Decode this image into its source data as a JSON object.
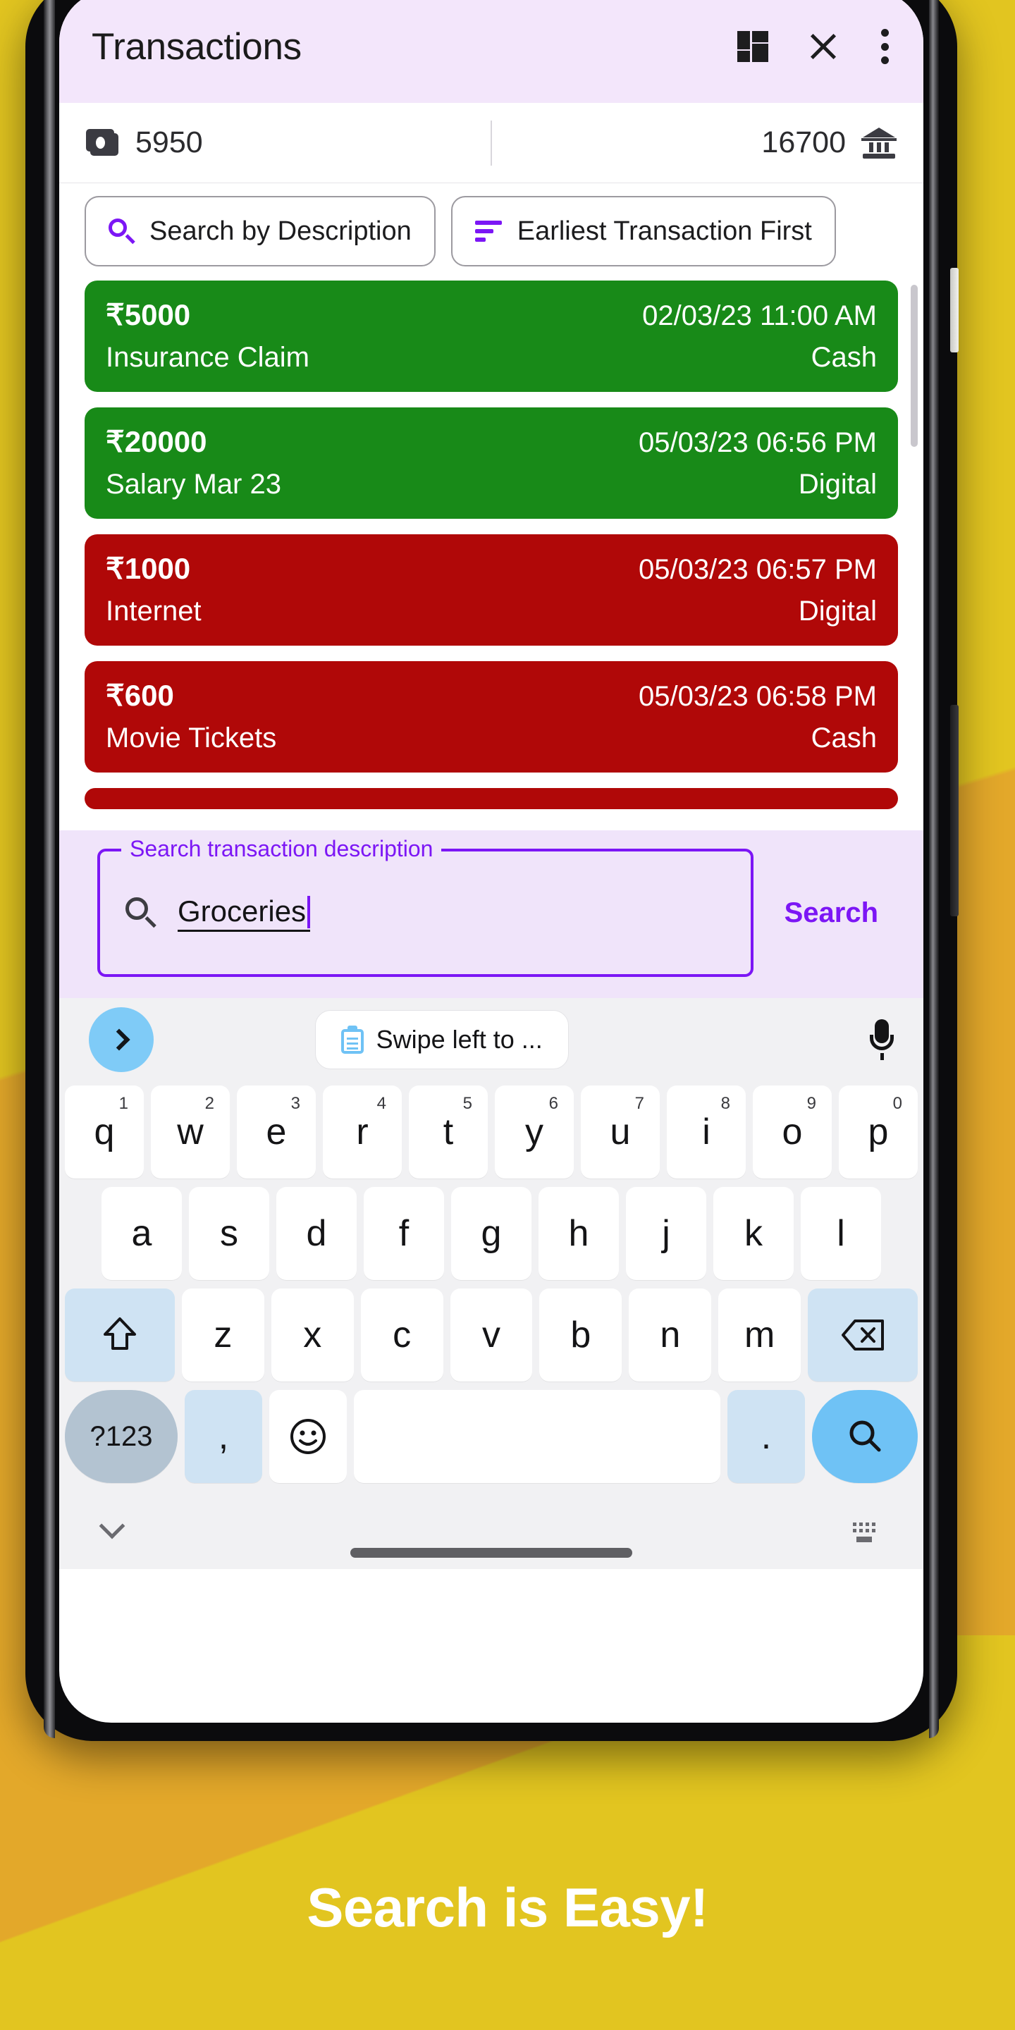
{
  "appbar": {
    "title": "Transactions",
    "icons": {
      "dashboard": "dashboard-icon",
      "close": "close-icon",
      "overflow": "more-vert-icon"
    }
  },
  "balances": {
    "cash": {
      "icon": "cash-icon",
      "value": "5950"
    },
    "bank": {
      "icon": "bank-icon",
      "value": "16700"
    }
  },
  "chips": [
    {
      "label": "Search by Description",
      "icon": "search-icon"
    },
    {
      "label": "Earliest Transaction First",
      "icon": "sort-icon"
    }
  ],
  "transactions": [
    {
      "amount": "₹5000",
      "date": "02/03/23 11:00 AM",
      "description": "Insurance Claim",
      "mode": "Cash",
      "type": "income"
    },
    {
      "amount": "₹20000",
      "date": "05/03/23 06:56 PM",
      "description": "Salary Mar 23",
      "mode": "Digital",
      "type": "income"
    },
    {
      "amount": "₹1000",
      "date": "05/03/23 06:57 PM",
      "description": "Internet",
      "mode": "Digital",
      "type": "expense"
    },
    {
      "amount": "₹600",
      "date": "05/03/23 06:58 PM",
      "description": "Movie Tickets",
      "mode": "Cash",
      "type": "expense"
    }
  ],
  "search_panel": {
    "label": "Search transaction description",
    "value": "Groceries",
    "placeholder": "Search transaction description",
    "button": "Search",
    "icon": "search-icon"
  },
  "keyboard": {
    "suggestion": {
      "next_icon": "chevron-right-icon",
      "clipboard_icon": "clipboard-icon",
      "clipboard_text": "Swipe left to ...",
      "mic_icon": "microphone-icon"
    },
    "row1": [
      {
        "key": "q",
        "num": "1"
      },
      {
        "key": "w",
        "num": "2"
      },
      {
        "key": "e",
        "num": "3"
      },
      {
        "key": "r",
        "num": "4"
      },
      {
        "key": "t",
        "num": "5"
      },
      {
        "key": "y",
        "num": "6"
      },
      {
        "key": "u",
        "num": "7"
      },
      {
        "key": "i",
        "num": "8"
      },
      {
        "key": "o",
        "num": "9"
      },
      {
        "key": "p",
        "num": "0"
      }
    ],
    "row2": [
      {
        "key": "a"
      },
      {
        "key": "s"
      },
      {
        "key": "d"
      },
      {
        "key": "f"
      },
      {
        "key": "g"
      },
      {
        "key": "h"
      },
      {
        "key": "j"
      },
      {
        "key": "k"
      },
      {
        "key": "l"
      }
    ],
    "row3": [
      {
        "key": "z"
      },
      {
        "key": "x"
      },
      {
        "key": "c"
      },
      {
        "key": "v"
      },
      {
        "key": "b"
      },
      {
        "key": "n"
      },
      {
        "key": "m"
      }
    ],
    "shift_icon": "shift-icon",
    "backspace_icon": "backspace-icon",
    "symbols_key": "?123",
    "comma_key": ",",
    "emoji_icon": "emoji-icon",
    "space_key": "",
    "period_key": ".",
    "search_key_icon": "search-icon",
    "hide_icon": "chevron-down-icon",
    "switch_icon": "keyboard-switch-icon"
  },
  "caption": {
    "text": "Search is Easy!"
  },
  "colors": {
    "background": "#E4B926",
    "band": "#E3A82A",
    "appbar": "#F3E6FB",
    "accent": "#7C16F5",
    "income": "#188A18",
    "expense": "#B00808",
    "panel": "#F0E4FA",
    "key_accent": "#6FC2F5"
  }
}
